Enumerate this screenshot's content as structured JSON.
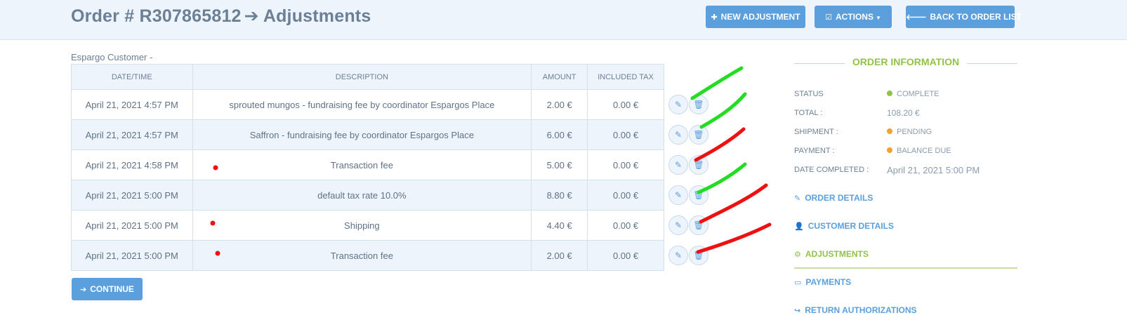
{
  "header": {
    "order_label": "Order # R307865812",
    "arrow_icon": "arrow-right-icon",
    "section": "Adjustments",
    "buttons": {
      "new_adjustment": "NEW ADJUSTMENT",
      "actions": "ACTIONS",
      "back_to_list": "BACK TO ORDER LIST"
    }
  },
  "customer_label": "Espargo Customer -",
  "table": {
    "columns": [
      "DATE/TIME",
      "DESCRIPTION",
      "AMOUNT",
      "INCLUDED TAX"
    ],
    "rows": [
      {
        "datetime": "April 21, 2021 4:57 PM",
        "description": "sprouted mungos - fundraising fee by coordinator Espargos Place",
        "amount": "2.00 €",
        "tax": "0.00 €"
      },
      {
        "datetime": "April 21, 2021 4:57 PM",
        "description": "Saffron - fundraising fee by coordinator Espargos Place",
        "amount": "6.00 €",
        "tax": "0.00 €"
      },
      {
        "datetime": "April 21, 2021 4:58 PM",
        "description": "Transaction fee",
        "amount": "5.00 €",
        "tax": "0.00 €"
      },
      {
        "datetime": "April 21, 2021 5:00 PM",
        "description": "default tax rate 10.0%",
        "amount": "8.80 €",
        "tax": "0.00 €"
      },
      {
        "datetime": "April 21, 2021 5:00 PM",
        "description": "Shipping",
        "amount": "4.40 €",
        "tax": "0.00 €"
      },
      {
        "datetime": "April 21, 2021 5:00 PM",
        "description": "Transaction fee",
        "amount": "2.00 €",
        "tax": "0.00 €"
      }
    ]
  },
  "continue_label": "CONTINUE",
  "sidebar": {
    "title": "ORDER INFORMATION",
    "status_label": "STATUS",
    "status_value": "COMPLETE",
    "total_label": "TOTAL :",
    "total_value": "108.20 €",
    "shipment_label": "SHIPMENT :",
    "shipment_value": "PENDING",
    "payment_label": "PAYMENT :",
    "payment_value": "BALANCE DUE",
    "date_completed_label": "DATE COMPLETED :",
    "date_completed_value": "April 21, 2021 5:00 PM",
    "links": {
      "order_details": "ORDER DETAILS",
      "customer_details": "CUSTOMER DETAILS",
      "adjustments": "ADJUSTMENTS",
      "payments": "PAYMENTS",
      "return_authorizations": "RETURN AUTHORIZATIONS"
    }
  },
  "colors": {
    "accent": "#5b9fdc",
    "active": "#93c24a",
    "status_complete": "#93c24a",
    "status_pending": "#f0a22e",
    "annotation_green": "#22dd22",
    "annotation_red": "#ee1111"
  }
}
